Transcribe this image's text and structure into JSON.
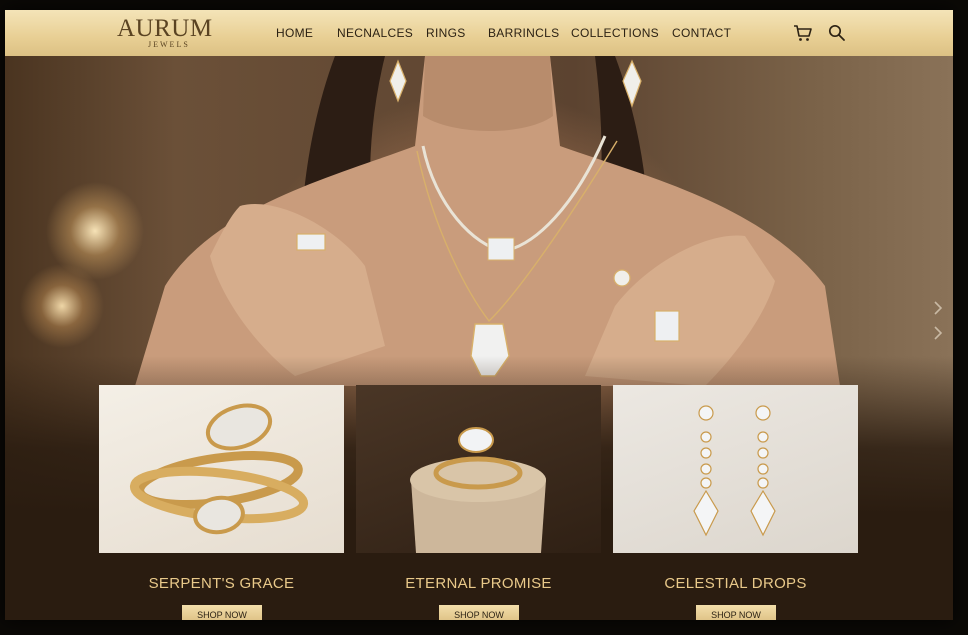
{
  "brand": {
    "name": "AURUM",
    "tagline": "JEWELS"
  },
  "nav": {
    "items": [
      "HOME",
      "NECNALCES",
      "RINGS",
      "BARRINCLS",
      "COLLECTIONS",
      "CONTACT"
    ]
  },
  "icons": {
    "cart": "cart-icon",
    "search": "search-icon",
    "next": "chevron-right-icon"
  },
  "products": [
    {
      "title": "SERPENT'S GRACE",
      "button": "SHOP NOW",
      "image": "serpent-ring-image"
    },
    {
      "title": "ETERNAL PROMISE",
      "button": "SHOP NOW",
      "image": "solitaire-ring-image"
    },
    {
      "title": "CELESTIAL DROPS",
      "button": "SHOP NOW",
      "image": "drop-earrings-image"
    }
  ],
  "colors": {
    "nav_gold": "#e8cf94",
    "title_gold": "#e9c98a",
    "dark_brown": "#2a1c10"
  }
}
